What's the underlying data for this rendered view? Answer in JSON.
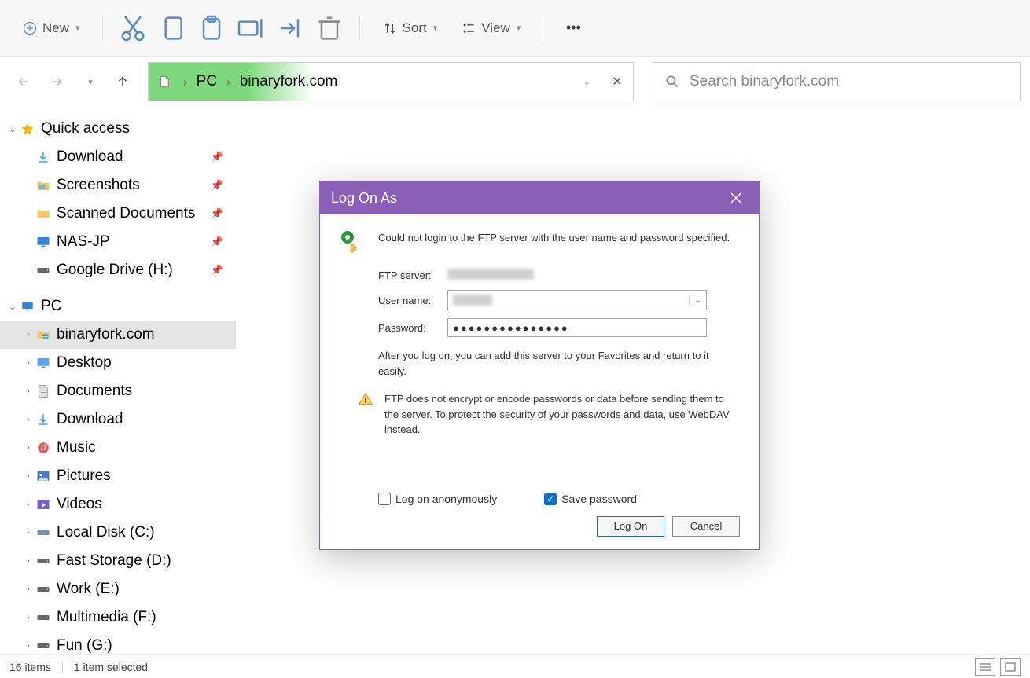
{
  "toolbar": {
    "new": "New",
    "sort": "Sort",
    "view": "View"
  },
  "breadcrumb": {
    "pc": "PC",
    "loc": "binaryfork.com"
  },
  "search": {
    "placeholder": "Search binaryfork.com"
  },
  "sidebar": {
    "quick": "Quick access",
    "quick_items": [
      {
        "label": "Download",
        "icon": "download"
      },
      {
        "label": "Screenshots",
        "icon": "folder-img"
      },
      {
        "label": "Scanned Documents",
        "icon": "folder"
      },
      {
        "label": "NAS-JP",
        "icon": "monitor"
      },
      {
        "label": "Google Drive (H:)",
        "icon": "drive"
      }
    ],
    "pc": "PC",
    "pc_items": [
      {
        "label": "binaryfork.com",
        "icon": "globe",
        "selected": true
      },
      {
        "label": "Desktop",
        "icon": "desktop"
      },
      {
        "label": "Documents",
        "icon": "doc"
      },
      {
        "label": "Download",
        "icon": "download"
      },
      {
        "label": "Music",
        "icon": "music"
      },
      {
        "label": "Pictures",
        "icon": "pictures"
      },
      {
        "label": "Videos",
        "icon": "videos"
      },
      {
        "label": "Local Disk (C:)",
        "icon": "disk"
      },
      {
        "label": "Fast Storage (D:)",
        "icon": "drive"
      },
      {
        "label": "Work (E:)",
        "icon": "drive"
      },
      {
        "label": "Multimedia (F:)",
        "icon": "drive"
      },
      {
        "label": "Fun (G:)",
        "icon": "drive"
      }
    ]
  },
  "status": {
    "count": "16 items",
    "sel": "1 item selected"
  },
  "dialog": {
    "title": "Log On As",
    "msg": "Could not login to the FTP server with the user name and password specified.",
    "ftp_label": "FTP server:",
    "user_label": "User name:",
    "pwd_label": "Password:",
    "pwd_value": "●●●●●●●●●●●●●●●",
    "note": "After you log on, you can add this server to your Favorites and return to it easily.",
    "warn": "FTP does not encrypt or encode passwords or data before sending them to the server.  To protect the security of your passwords and data, use WebDAV instead.",
    "anon": "Log on anonymously",
    "save": "Save password",
    "logon": "Log On",
    "cancel": "Cancel"
  }
}
